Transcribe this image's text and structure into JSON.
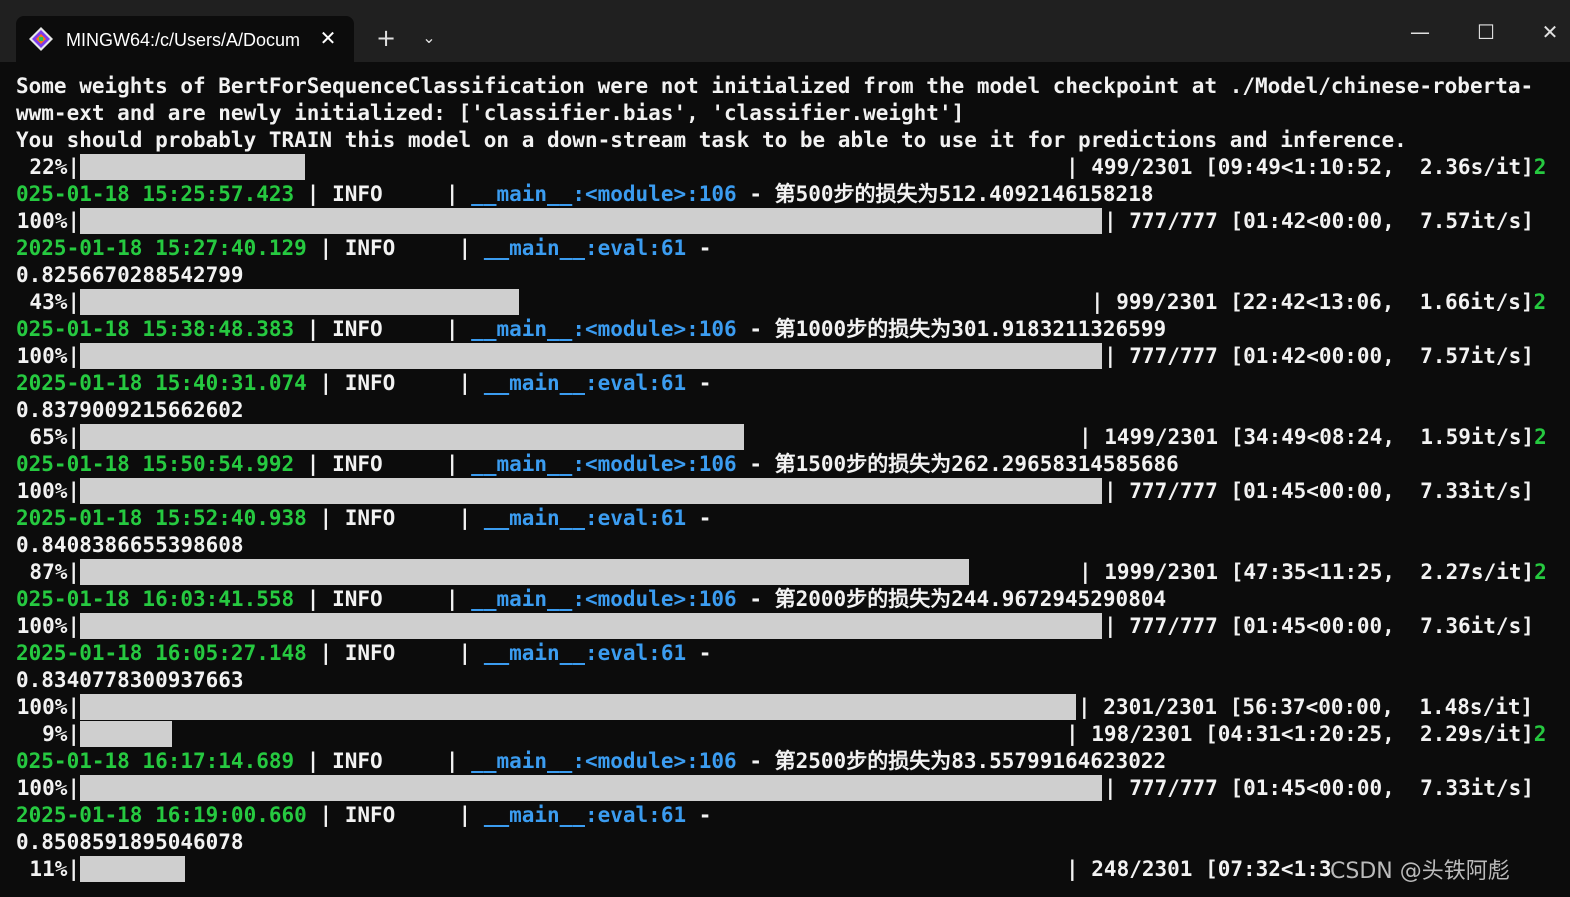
{
  "tab": {
    "title": "MINGW64:/c/Users/A/Docum",
    "close": "✕"
  },
  "titlebar": {
    "new_tab": "+",
    "dropdown": "⌄",
    "minimize": "—",
    "maximize": "☐",
    "close": "✕"
  },
  "colors": {
    "timestamp": "#26c940",
    "module": "#3b9cf0",
    "text": "#f2f2f2",
    "bar": "#cfcfcf",
    "background": "#0c0c0c"
  },
  "lines": {
    "l1": "Some weights of BertForSequenceClassification were not initialized from the model checkpoint at ./Model/chinese-roberta-",
    "l2": "wwm-ext and are newly initialized: ['classifier.bias', 'classifier.weight']",
    "l3": "You should probably TRAIN this model on a down-stream task to be able to use it for predictions and inference."
  },
  "progress": [
    {
      "pct": "22%|",
      "fraction": 0.22,
      "info": "| 499/2301 [09:49<1:10:52,  2.36s/it]",
      "tail": "2"
    },
    {
      "pct": "100%|",
      "fraction": 1.0,
      "info": "| 777/777 [01:42<00:00,  7.57it/s]",
      "tail": ""
    },
    {
      "pct": "43%|",
      "fraction": 0.43,
      "info": "| 999/2301 [22:42<13:06,  1.66it/s]",
      "tail": "2"
    },
    {
      "pct": "100%|",
      "fraction": 1.0,
      "info": "| 777/777 [01:42<00:00,  7.57it/s]",
      "tail": ""
    },
    {
      "pct": "65%|",
      "fraction": 0.65,
      "info": "| 1499/2301 [34:49<08:24,  1.59it/s]",
      "tail": "2"
    },
    {
      "pct": "100%|",
      "fraction": 1.0,
      "info": "| 777/777 [01:45<00:00,  7.33it/s]",
      "tail": ""
    },
    {
      "pct": "87%|",
      "fraction": 0.87,
      "info": "| 1999/2301 [47:35<11:25,  2.27s/it]",
      "tail": "2"
    },
    {
      "pct": "100%|",
      "fraction": 1.0,
      "info": "| 777/777 [01:45<00:00,  7.36it/s]",
      "tail": ""
    },
    {
      "pct": "100%|",
      "fraction": 1.0,
      "info": "| 2301/2301 [56:37<00:00,  1.48s/it]",
      "tail": ""
    },
    {
      "pct": "9%|",
      "fraction": 0.09,
      "info": "| 198/2301 [04:31<1:20:25,  2.29s/it]",
      "tail": "2"
    },
    {
      "pct": "100%|",
      "fraction": 1.0,
      "info": "| 777/777 [01:45<00:00,  7.33it/s]",
      "tail": ""
    },
    {
      "pct": "11%|",
      "fraction": 0.11,
      "info": "| 248/2301 [07:32<1:3",
      "tail": ""
    }
  ],
  "logs": [
    {
      "ts": "025-01-18 15:25:57.423",
      "level": " | INFO     | ",
      "mod": "__main__:<module>:106",
      "msg": " - 第500步的损失为512.4092146158218"
    },
    {
      "ts": "2025-01-18 15:27:40.129",
      "level": " | INFO     | ",
      "mod": "__main__:eval:61",
      "msg": " -"
    },
    {
      "ts": "025-01-18 15:38:48.383",
      "level": " | INFO     | ",
      "mod": "__main__:<module>:106",
      "msg": " - 第1000步的损失为301.9183211326599"
    },
    {
      "ts": "2025-01-18 15:40:31.074",
      "level": " | INFO     | ",
      "mod": "__main__:eval:61",
      "msg": " -"
    },
    {
      "ts": "025-01-18 15:50:54.992",
      "level": " | INFO     | ",
      "mod": "__main__:<module>:106",
      "msg": " - 第1500步的损失为262.29658314585686"
    },
    {
      "ts": "2025-01-18 15:52:40.938",
      "level": " | INFO     | ",
      "mod": "__main__:eval:61",
      "msg": " -"
    },
    {
      "ts": "025-01-18 16:03:41.558",
      "level": " | INFO     | ",
      "mod": "__main__:<module>:106",
      "msg": " - 第2000步的损失为244.9672945290804"
    },
    {
      "ts": "2025-01-18 16:05:27.148",
      "level": " | INFO     | ",
      "mod": "__main__:eval:61",
      "msg": " -"
    },
    {
      "ts": "025-01-18 16:17:14.689",
      "level": " | INFO     | ",
      "mod": "__main__:<module>:106",
      "msg": " - 第2500步的损失为83.55799164623022"
    },
    {
      "ts": "2025-01-18 16:19:00.660",
      "level": " | INFO     | ",
      "mod": "__main__:eval:61",
      "msg": " -"
    }
  ],
  "eval_values": [
    "0.8256670288542799",
    "0.8379009215662602",
    "0.8408386655398608",
    "0.8340778300937663",
    "0.8508591895046078"
  ],
  "watermark": "CSDN @头铁阿彪"
}
